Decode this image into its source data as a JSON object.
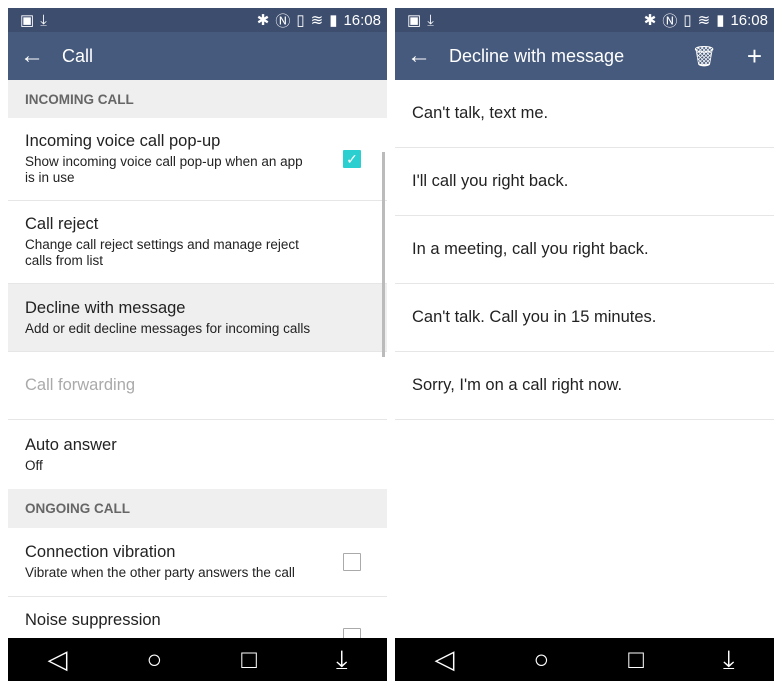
{
  "status": {
    "time": "16:08",
    "icons": [
      "gallery-icon",
      "download-icon",
      "bluetooth-icon",
      "nfc-icon",
      "vibrate-icon",
      "wifi-icon",
      "sim-icon",
      "signal-icon",
      "battery-icon"
    ]
  },
  "left": {
    "title": "Call",
    "sections": [
      {
        "header": "INCOMING CALL"
      },
      {
        "header": "ONGOING CALL"
      }
    ],
    "items": [
      {
        "title": "Incoming voice call pop-up",
        "subtitle": "Show incoming voice call pop-up when an app is in use",
        "checked": true
      },
      {
        "title": "Call reject",
        "subtitle": "Change call reject settings and manage reject calls from list"
      },
      {
        "title": "Decline with message",
        "subtitle": "Add or edit decline messages for incoming calls"
      },
      {
        "title": "Call forwarding",
        "disabled": true
      },
      {
        "title": "Auto answer",
        "subtitle": "Off"
      },
      {
        "title": "Connection vibration",
        "subtitle": "Vibrate when the other party answers the call",
        "checked": false
      },
      {
        "title": "Noise suppression",
        "checked": false
      }
    ]
  },
  "right": {
    "title": "Decline with message",
    "messages": [
      "Can't talk, text me.",
      "I'll call you right back.",
      "In a meeting, call you right back.",
      "Can't talk. Call you in 15 minutes.",
      "Sorry, I'm on a call right now."
    ]
  },
  "colors": {
    "statusbar": "#3d4d6e",
    "toolbar": "#455a7c",
    "accent": "#2ccfcf"
  }
}
